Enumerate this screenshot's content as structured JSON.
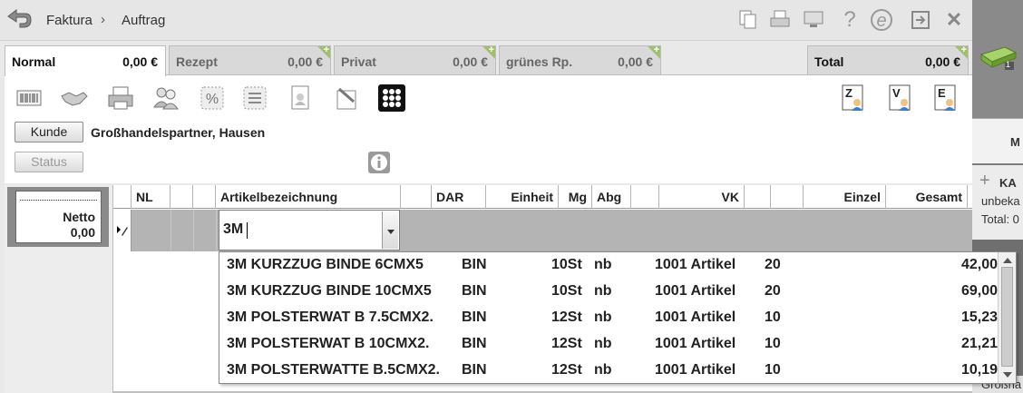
{
  "breadcrumb": {
    "items": [
      "Faktura",
      "Auftrag"
    ],
    "separator": "›"
  },
  "toolbar": {
    "icons": [
      "copy-icon",
      "print-icon",
      "monitor-icon",
      "help-icon",
      "edition-icon",
      "exit-window-icon",
      "close-icon"
    ],
    "help_glyph": "?",
    "edition_glyph": "e",
    "close_glyph": "✕"
  },
  "tabs": [
    {
      "label": "Normal",
      "value": "0,00 €",
      "active": true
    },
    {
      "label": "Rezept",
      "value": "0,00 €",
      "active": false
    },
    {
      "label": "Privat",
      "value": "0,00 €",
      "active": false
    },
    {
      "label": "grünes Rp.",
      "value": "0,00 €",
      "active": false
    }
  ],
  "tab_plus": "+",
  "total": {
    "label": "Total",
    "value": "0,00 €"
  },
  "action_icons": [
    "barcode-icon",
    "handshake-icon",
    "printer-icon",
    "customers-icon",
    "discount-icon",
    "calculator-icon",
    "document-person-icon",
    "pen-document-icon",
    "grid-dots-icon"
  ],
  "zve_buttons": [
    {
      "letter": "Z",
      "icon": "z-person-icon"
    },
    {
      "letter": "V",
      "icon": "v-person-icon"
    },
    {
      "letter": "E",
      "icon": "e-person-icon"
    }
  ],
  "customer": {
    "button_label": "Kunde",
    "name": "Großhandelspartner, Hausen",
    "status_label": "Status"
  },
  "netto": {
    "label": "Netto",
    "value": "0,00"
  },
  "grid": {
    "columns": [
      "NL",
      "Artikelbezeichnung",
      "DAR",
      "Einheit",
      "Mg",
      "Abg",
      "VK",
      "Einzel",
      "Gesamt"
    ],
    "search_value": "3M"
  },
  "dropdown": {
    "rows": [
      {
        "name": "3M KURZZUG BINDE 6CMX5",
        "dar": "BIN",
        "einheit": "10St",
        "abg": "nb",
        "info": "1001 Artikel",
        "code": "20",
        "price": "42,00"
      },
      {
        "name": "3M KURZZUG BINDE 10CMX5",
        "dar": "BIN",
        "einheit": "10St",
        "abg": "nb",
        "info": "1001 Artikel",
        "code": "20",
        "price": "69,00"
      },
      {
        "name": "3M POLSTERWAT B 7.5CMX2.",
        "dar": "BIN",
        "einheit": "12St",
        "abg": "nb",
        "info": "1001 Artikel",
        "code": "10",
        "price": "15,23"
      },
      {
        "name": "3M POLSTERWAT B 10CMX2.",
        "dar": "BIN",
        "einheit": "12St",
        "abg": "nb",
        "info": "1001 Artikel",
        "code": "10",
        "price": "21,21"
      },
      {
        "name": "3M POLSTERWATTE B.5CMX2.",
        "dar": "BIN",
        "einheit": "12St",
        "abg": "nb",
        "info": "1001 Artikel",
        "code": "10",
        "price": "10,19"
      }
    ]
  },
  "side_panel": {
    "header": "M",
    "plus": "+",
    "ka_label": "KA",
    "unbekannt": "unbeka",
    "total": "Total: 0",
    "bottom": "Großha",
    "badge": "1"
  },
  "colors": {
    "accent_green": "#a0c070",
    "edit_row": "#b4b4b4"
  }
}
